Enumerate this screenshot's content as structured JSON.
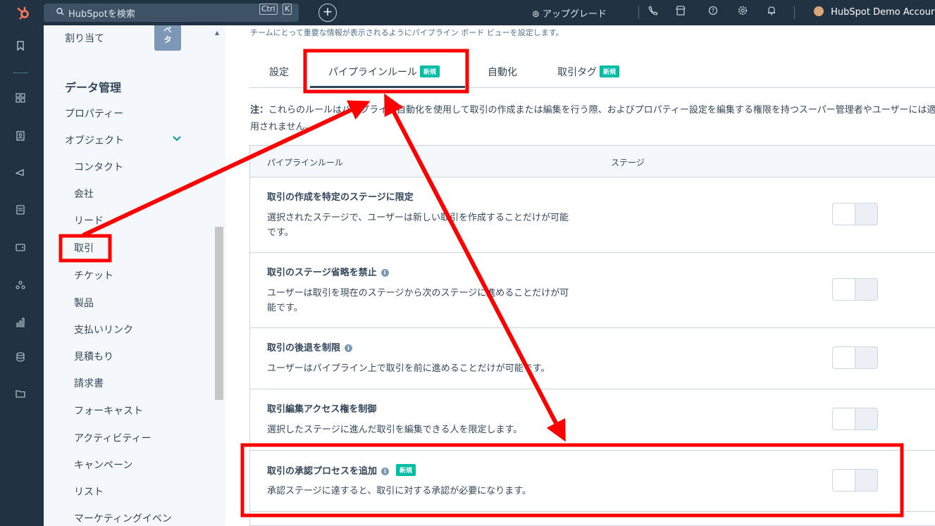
{
  "topbar": {
    "search_placeholder": "HubSpotを検索",
    "kbd_ctrl": "Ctrl",
    "kbd_k": "K",
    "plus": "+",
    "upgrade": "アップグレード",
    "account": "HubSpot Demo Accour",
    "icons": [
      "phone-icon",
      "marketplace-icon",
      "help-icon",
      "settings-gear-icon",
      "bell-icon"
    ]
  },
  "sidebar": {
    "assign": "割り当て",
    "beta_line1": "ベ",
    "beta_line2": "タ",
    "data_mgmt": "データ管理",
    "properties": "プロパティー",
    "objects": "オブジェクト",
    "items": [
      "コンタクト",
      "会社",
      "リード",
      "取引",
      "チケット",
      "製品",
      "支払いリンク",
      "見積もり",
      "請求書",
      "フォーキャスト",
      "アクティビティー",
      "キャンペーン",
      "リスト",
      "マーケティングイベン"
    ]
  },
  "main": {
    "subtitle": "チームにとって重要な情報が表示されるようにパイプライン ボード ビューを設定します。",
    "tabs": [
      "設定",
      "パイプラインルール",
      "自動化",
      "取引タグ"
    ],
    "new_badge": "新規",
    "note_bold": "注：",
    "note_text": "これらのルールはパイプライン自動化を使用して取引の作成または編集を行う際、およびプロパティー設定を編集する権限を持つスーパー管理者やユーザーには適用されません。",
    "table_headers": [
      "パイプラインルール",
      "ステージ"
    ],
    "rows": [
      {
        "title": "取引の作成を特定のステージに限定",
        "desc": "選択されたステージで、ユーザーは新しい取引を作成することだけが可能です。",
        "enabled": false
      },
      {
        "title": "取引のステージ省略を禁止",
        "desc": "ユーザーは取引を現在のステージから次のステージに進めることだけが可能です。",
        "enabled": false
      },
      {
        "title": "取引の後退を制限",
        "desc": "ユーザーはパイプライン上で取引を前に進めることだけが可能です。",
        "enabled": false
      },
      {
        "title": "取引編集アクセス権を制御",
        "desc": "選択したステージに進んだ取引を編集できる人を限定します。",
        "enabled": false
      },
      {
        "title": "取引の承認プロセスを追加",
        "desc": "承認ステージに達すると、取引に対する承認が必要になります。",
        "enabled": false
      }
    ]
  },
  "annotation_color": "#ff0000"
}
